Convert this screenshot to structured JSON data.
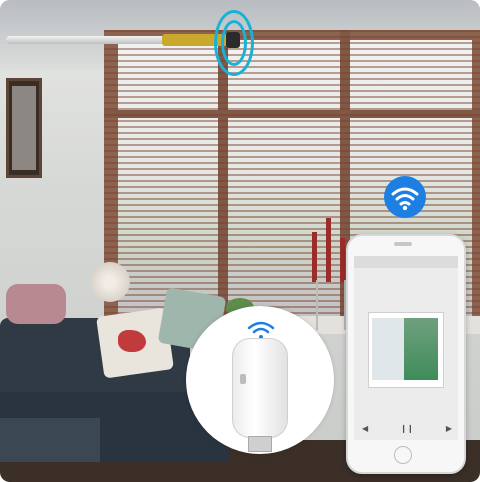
{
  "scene": {
    "phone_screen_title": "",
    "colors": {
      "wifi_badge": "#1e7fe3",
      "signal_rings": "#19b2d7",
      "motor": "#caa82b",
      "window_frame": "#7a4a34"
    },
    "icons": [
      "wifi-icon",
      "wifi-signal-icon"
    ]
  }
}
